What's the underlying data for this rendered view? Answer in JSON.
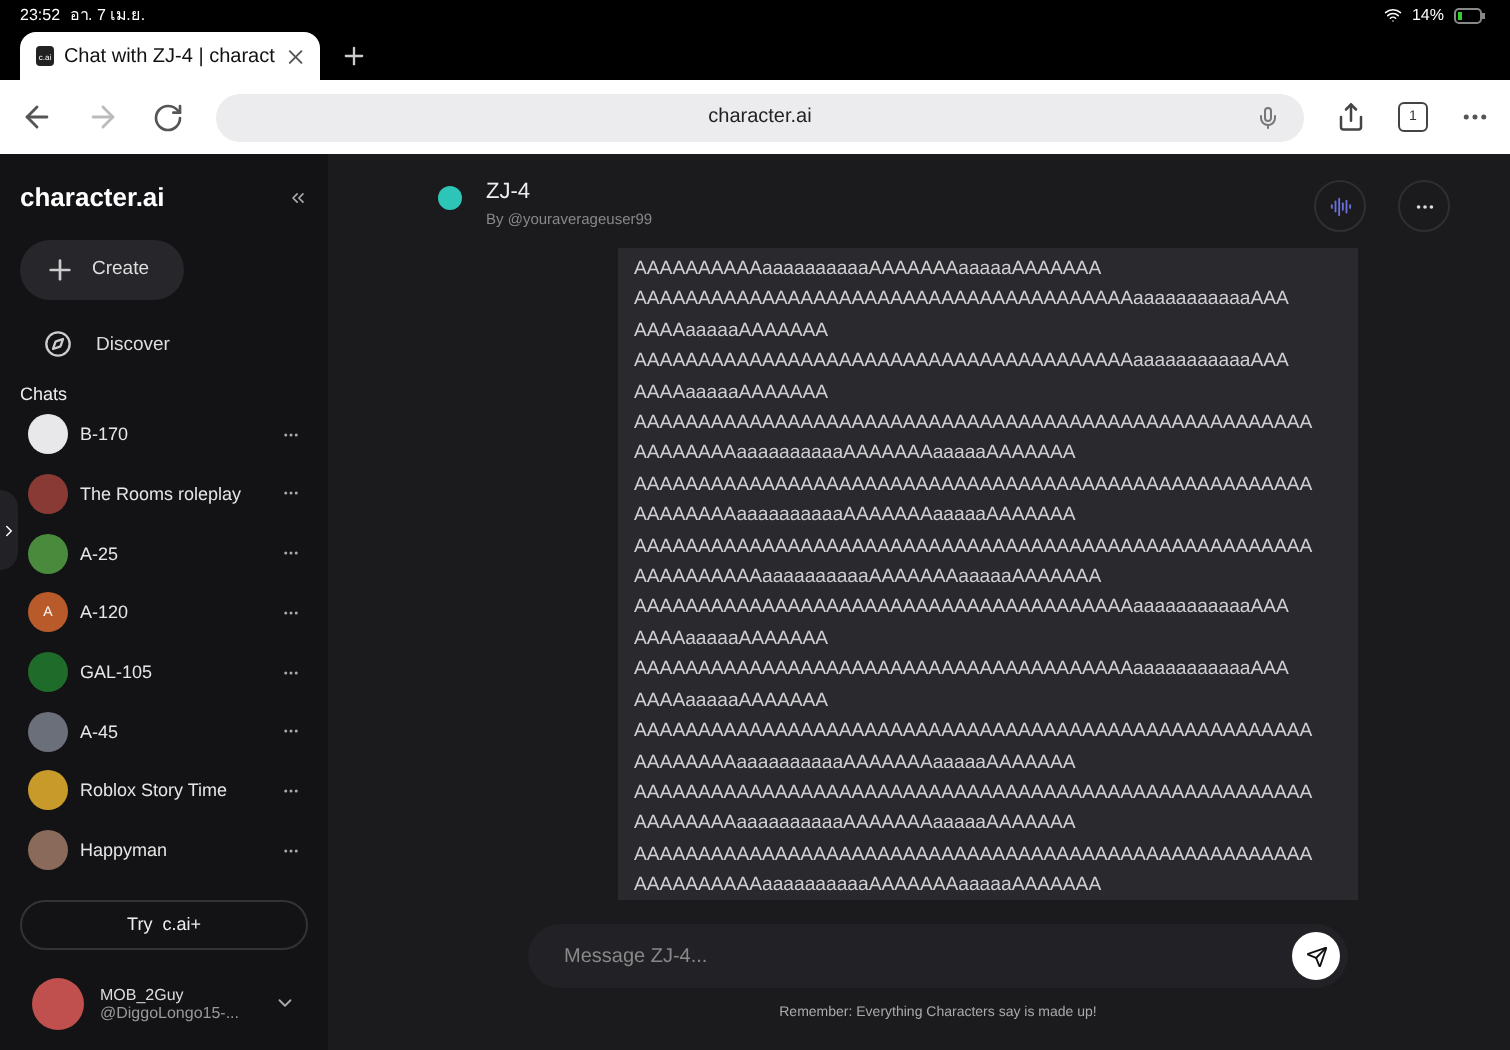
{
  "status_bar": {
    "time": "23:52",
    "date": "อา. 7 เม.ย.",
    "battery": "14%"
  },
  "browser": {
    "tab_title": "Chat with ZJ-4 | charact",
    "tab_favicon": "c.ai",
    "url": "character.ai",
    "tab_count": "1"
  },
  "sidebar": {
    "logo": "character.ai",
    "create": "Create",
    "discover": "Discover",
    "chats_heading": "Chats",
    "chats": [
      {
        "name": "B-170",
        "color": "#e8e8ea"
      },
      {
        "name": "The Rooms roleplay",
        "color": "#8a3a34"
      },
      {
        "name": "A-25",
        "color": "#4a8a3c"
      },
      {
        "name": "A-120",
        "color": "#b85a2a",
        "initial": "A"
      },
      {
        "name": "GAL-105",
        "color": "#1f6b2a"
      },
      {
        "name": "A-45",
        "color": "#6a6f7a"
      },
      {
        "name": "Roblox Story Time",
        "color": "#c89a2a"
      },
      {
        "name": "Happyman",
        "color": "#8a6a5a"
      }
    ],
    "upgrade": "Try  c.ai+",
    "user": {
      "name": "MOB_2Guy",
      "handle": "@DiggoLongo15-..."
    }
  },
  "chat": {
    "title": "ZJ-4",
    "author": "By @youraverageuser99",
    "message_lines": [
      "AAAAAAAAAAaaaaaaaaaaAAAAAAAaaaaaAAAAAAA",
      "AAAAAAAAAAAAAAAAAAAAAAAAAAAAAAAAAAAAAAAaaaaaaaaaaaAAA",
      "AAAAaaaaaAAAAAAA",
      "AAAAAAAAAAAAAAAAAAAAAAAAAAAAAAAAAAAAAAAaaaaaaaaaaaAAA",
      "AAAAaaaaaAAAAAAA",
      "AAAAAAAAAAAAAAAAAAAAAAAAAAAAAAAAAAAAAAAAAAAAAAAAAAAAA",
      "AAAAAAAAaaaaaaaaaaAAAAAAAaaaaaAAAAAAA",
      "AAAAAAAAAAAAAAAAAAAAAAAAAAAAAAAAAAAAAAAAAAAAAAAAAAAAA",
      "AAAAAAAAaaaaaaaaaaAAAAAAAaaaaaAAAAAAA",
      "AAAAAAAAAAAAAAAAAAAAAAAAAAAAAAAAAAAAAAAAAAAAAAAAAAAAA",
      "AAAAAAAAAAaaaaaaaaaaAAAAAAAaaaaaAAAAAAA",
      "AAAAAAAAAAAAAAAAAAAAAAAAAAAAAAAAAAAAAAAaaaaaaaaaaaAAA",
      "AAAAaaaaaAAAAAAA",
      "AAAAAAAAAAAAAAAAAAAAAAAAAAAAAAAAAAAAAAAaaaaaaaaaaaAAA",
      "AAAAaaaaaAAAAAAA",
      "AAAAAAAAAAAAAAAAAAAAAAAAAAAAAAAAAAAAAAAAAAAAAAAAAAAAA",
      "AAAAAAAAaaaaaaaaaaAAAAAAAaaaaaAAAAAAA",
      "AAAAAAAAAAAAAAAAAAAAAAAAAAAAAAAAAAAAAAAAAAAAAAAAAAAAA",
      "AAAAAAAAaaaaaaaaaaAAAAAAAaaaaaAAAAAAA",
      "AAAAAAAAAAAAAAAAAAAAAAAAAAAAAAAAAAAAAAAAAAAAAAAAAAAAA",
      "AAAAAAAAAAaaaaaaaaaaAAAAAAAaaaaaAAAAAAA"
    ],
    "input": {
      "placeholder": "Message ZJ-4..."
    },
    "disclaimer": "Remember: Everything Characters say is made up!"
  }
}
